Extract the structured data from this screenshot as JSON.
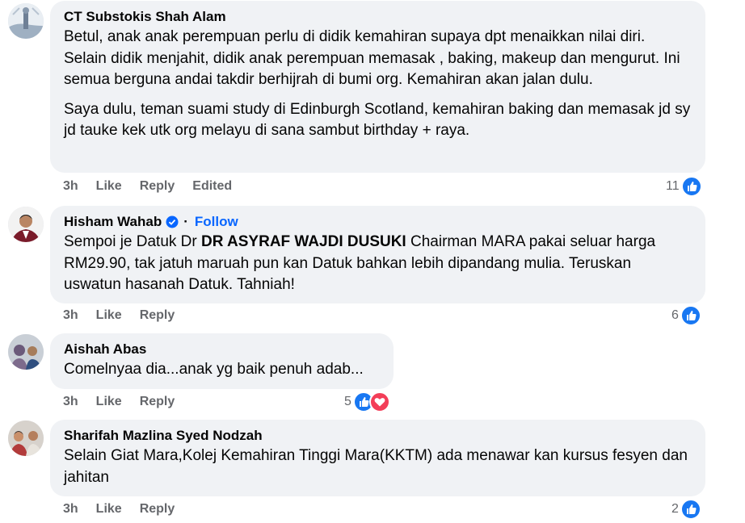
{
  "comments": [
    {
      "author": "CT Substokis Shah Alam",
      "paragraphs": [
        "Betul, anak anak perempuan perlu di didik kemahiran supaya dpt menaikkan nilai diri. Selain didik menjahit, didik anak perempuan memasak , baking, makeup dan mengurut. Ini semua berguna andai takdir berhijrah di bumi org. Kemahiran akan jalan dulu.",
        "Saya dulu, teman suami study di Edinburgh Scotland, kemahiran baking dan memasak jd sy jd tauke kek utk org melayu di sana sambut birthday + raya."
      ],
      "time": "3h",
      "like": "Like",
      "reply": "Reply",
      "edited": "Edited",
      "reaction_count": "11"
    },
    {
      "author": "Hisham Wahab",
      "follow": "Follow",
      "separator": "·",
      "text_pre": "Sempoi je Datuk Dr ",
      "text_bold": "DR ASYRAF WAJDI DUSUKI",
      "text_post": " Chairman MARA pakai seluar harga RM29.90, tak jatuh maruah pun kan Datuk bahkan lebih dipandang mulia. Teruskan uswatun hasanah Datuk. Tahniah!",
      "time": "3h",
      "like": "Like",
      "reply": "Reply",
      "reaction_count": "6"
    },
    {
      "author": "Aishah Abas",
      "text": "Comelnyaa dia...anak yg baik penuh adab...",
      "time": "3h",
      "like": "Like",
      "reply": "Reply",
      "reaction_count": "5"
    },
    {
      "author": "Sharifah Mazlina Syed Nodzah",
      "text": "Selain Giat Mara,Kolej Kemahiran Tinggi Mara(KKTM) ada menawar kan kursus fesyen dan jahitan",
      "time": "3h",
      "like": "Like",
      "reply": "Reply",
      "reaction_count": "2"
    }
  ],
  "colors": {
    "bubble": "#f0f2f5",
    "meta_text": "#65676b",
    "link_blue": "#0866ff",
    "like_blue": "#1877f2",
    "love_red": "#f33e58"
  },
  "icons": {
    "like": "thumbs-up-icon",
    "love": "heart-icon",
    "verified": "verified-badge-icon"
  }
}
